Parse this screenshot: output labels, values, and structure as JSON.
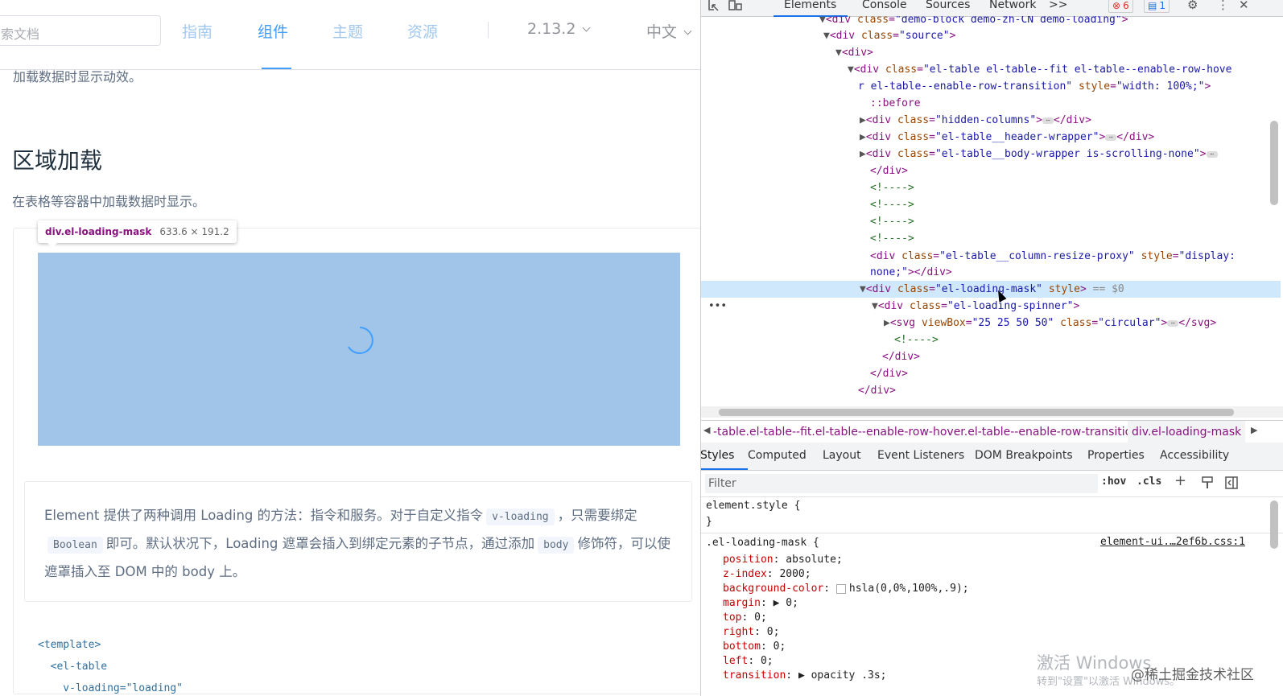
{
  "page": {
    "search_placeholder": "索文档",
    "nav": [
      "指南",
      "组件",
      "主题",
      "资源"
    ],
    "version": "2.13.2",
    "lang": "中文",
    "prev_text": "加载数据时显示动效。",
    "section_title": "区域加载",
    "section_desc": "在表格等容器中加载数据时显示。",
    "tooltip_name": "div.el-loading-mask",
    "tooltip_size": "633.6 × 191.2",
    "desc": {
      "p1": "Element 提供了两种调用 Loading 的方法：指令和服务。对于自定义指令",
      "c1": "v-loading",
      "p2": "，只需要绑定",
      "c2": "Boolean",
      "p3": "即可。默认状况下，Loading 遮罩会插入到绑定元素的子节点，通过添加",
      "c3": "body",
      "p4": "修饰符，可以使遮罩插入至 DOM 中的 body 上。"
    },
    "code": [
      "<template>",
      "  <el-table",
      "    v-loading=\"loading\""
    ]
  },
  "devtools": {
    "tabs": {
      "elements": "Elements",
      "console": "Console",
      "sources": "Sources",
      "network": "Network",
      "more": ">>"
    },
    "errors": "6",
    "messages": "1",
    "breadcrumb_1": "-table.el-table--fit.el-table--enable-row-hover.el-table--enable-row-transition",
    "breadcrumb_2": "div.el-loading-mask",
    "subtabs": [
      "Styles",
      "Computed",
      "Layout",
      "Event Listeners",
      "DOM Breakpoints",
      "Properties",
      "Accessibility"
    ],
    "filter_placeholder": "Filter",
    "hov": ":hov",
    "cls": ".cls",
    "element_style": "element.style {",
    "close_brace": "}",
    "rule_selector": ".el-loading-mask {",
    "rule_source": "element-ui.…2ef6b.css:1",
    "props": [
      {
        "name": "position",
        "value": "absolute;"
      },
      {
        "name": "z-index",
        "value": "2000;"
      },
      {
        "name": "background-color",
        "value": "hsla(0,0%,100%,.9);"
      },
      {
        "name": "margin",
        "value": "▶ 0;"
      },
      {
        "name": "top",
        "value": "0;"
      },
      {
        "name": "right",
        "value": "0;"
      },
      {
        "name": "bottom",
        "value": "0;"
      },
      {
        "name": "left",
        "value": "0;"
      },
      {
        "name": "transition",
        "value": "▶ opacity .3s;"
      }
    ]
  },
  "watermark": {
    "line1": "激活 Windows",
    "line2": "转到\"设置\"以激活 Windows。"
  },
  "credit": "@稀土掘金技术社区",
  "colors": {
    "accent": "#409eff",
    "selection": "#cfe8fc",
    "mask": "#a0c5e8"
  }
}
